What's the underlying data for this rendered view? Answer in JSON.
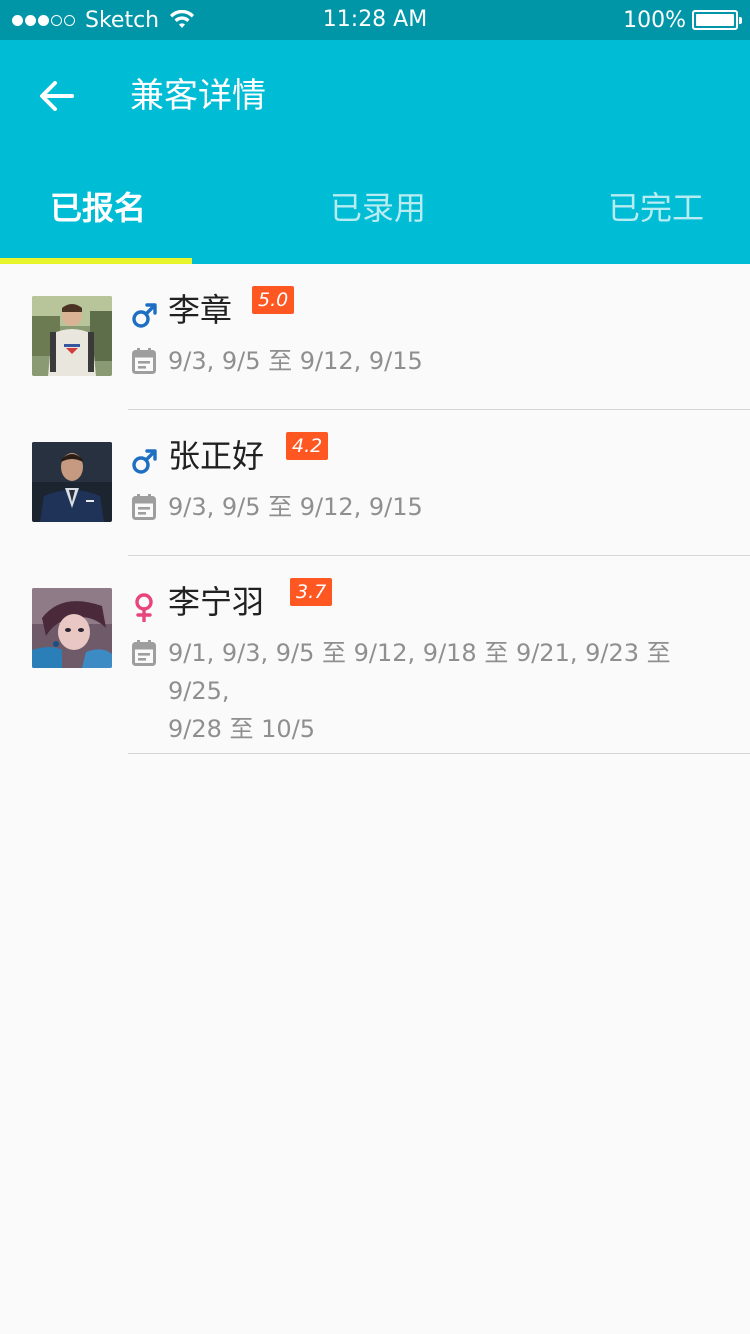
{
  "status_bar": {
    "carrier": "Sketch",
    "time": "11:28 AM",
    "battery": "100%",
    "battery_level": 1.0,
    "signal_bars_filled": 3,
    "signal_bars_total": 5
  },
  "app_bar": {
    "back_icon": "arrow-left-icon",
    "title": "兼客详情",
    "color": "#00bcd4"
  },
  "tabs": [
    {
      "label": "已报名",
      "active": true
    },
    {
      "label": "已录用",
      "active": false
    },
    {
      "label": "已完工",
      "active": false
    }
  ],
  "indicator_color": "#e8f52a",
  "workers": [
    {
      "name": "李章",
      "gender": "male",
      "gender_icon": "male-symbol-icon",
      "rating": "5.0",
      "dates_line1": "9/3, 9/5 至 9/12, 9/15",
      "dates_line2": ""
    },
    {
      "name": "张正好",
      "gender": "male",
      "gender_icon": "male-symbol-icon",
      "rating": "4.2",
      "dates_line1": "9/3, 9/5 至 9/12, 9/15",
      "dates_line2": ""
    },
    {
      "name": "李宁羽",
      "gender": "female",
      "gender_icon": "female-symbol-icon",
      "rating": "3.7",
      "dates_line1": "9/1, 9/3, 9/5 至 9/12, 9/18 至 9/21, 9/23 至 9/25,",
      "dates_line2": "9/28 至 10/5"
    }
  ],
  "colors": {
    "male": "#1e6fc4",
    "female": "#e8457a",
    "badge": "#ff5722"
  }
}
